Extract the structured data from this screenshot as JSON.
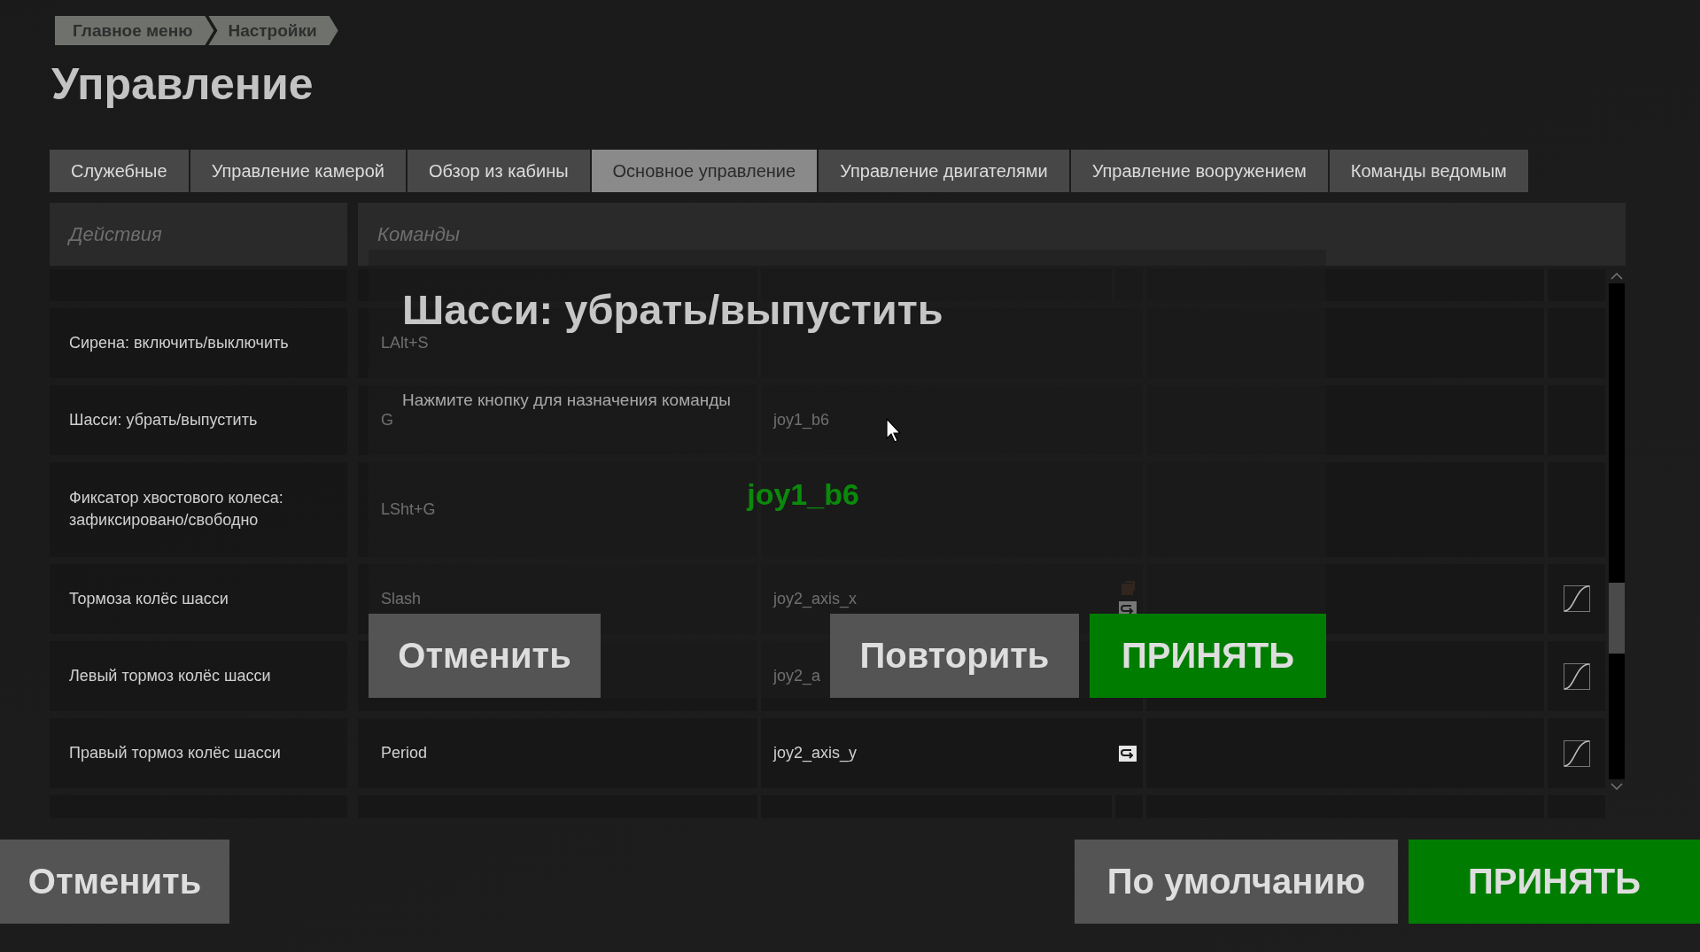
{
  "breadcrumb": [
    "Главное меню",
    "Настройки"
  ],
  "title": "Управление",
  "tabs": [
    {
      "label": "Служебные",
      "selected": false
    },
    {
      "label": "Управление камерой",
      "selected": false
    },
    {
      "label": "Обзор из кабины",
      "selected": false
    },
    {
      "label": "Основное управление",
      "selected": true
    },
    {
      "label": "Управление двигателями",
      "selected": false
    },
    {
      "label": "Управление вооружением",
      "selected": false
    },
    {
      "label": "Команды ведомым",
      "selected": false
    }
  ],
  "table": {
    "columns": [
      "Действия",
      "Команды"
    ],
    "rows": [
      {
        "action": "Сирена: включить/выключить",
        "key": "LAlt+S",
        "joystick": "",
        "icons": [],
        "curve": false
      },
      {
        "action": "Шасси: убрать/выпустить",
        "key": "G",
        "joystick": "joy1_b6",
        "icons": [],
        "curve": false
      },
      {
        "action": "Фиксатор хвостового колеса: зафиксировано/свободно",
        "key": "LSht+G",
        "joystick": "",
        "icons": [],
        "curve": false
      },
      {
        "action": "Тормоза колёс шасси",
        "key": "Slash",
        "joystick": "joy2_axis_x",
        "icons": [
          {
            "kind": "square"
          },
          {
            "kind": "swap"
          }
        ],
        "curve": true
      },
      {
        "action": "Левый тормоз колёс шасси",
        "key": "",
        "joystick": "joy2_a",
        "icons": [],
        "curve": true
      },
      {
        "action": "Правый тормоз колёс шасси",
        "key": "Period",
        "joystick": "joy2_axis_y",
        "icons": [
          {
            "kind": "swap"
          }
        ],
        "curve": true
      }
    ]
  },
  "dialog": {
    "title": "Шасси: убрать/выпустить",
    "hint": "Нажмите кнопку для назначения команды",
    "captured": "joy1_b6",
    "buttons": [
      {
        "label": "Отменить",
        "kind": "secondary"
      },
      {
        "label": "Повторить",
        "kind": "secondary"
      },
      {
        "label": "ПРИНЯТЬ",
        "kind": "primary"
      }
    ]
  },
  "footer_buttons": [
    {
      "label": "Отменить",
      "kind": "secondary"
    },
    {
      "label": "По умолчанию",
      "kind": "secondary"
    },
    {
      "label": "ПРИНЯТЬ",
      "kind": "primary"
    }
  ]
}
